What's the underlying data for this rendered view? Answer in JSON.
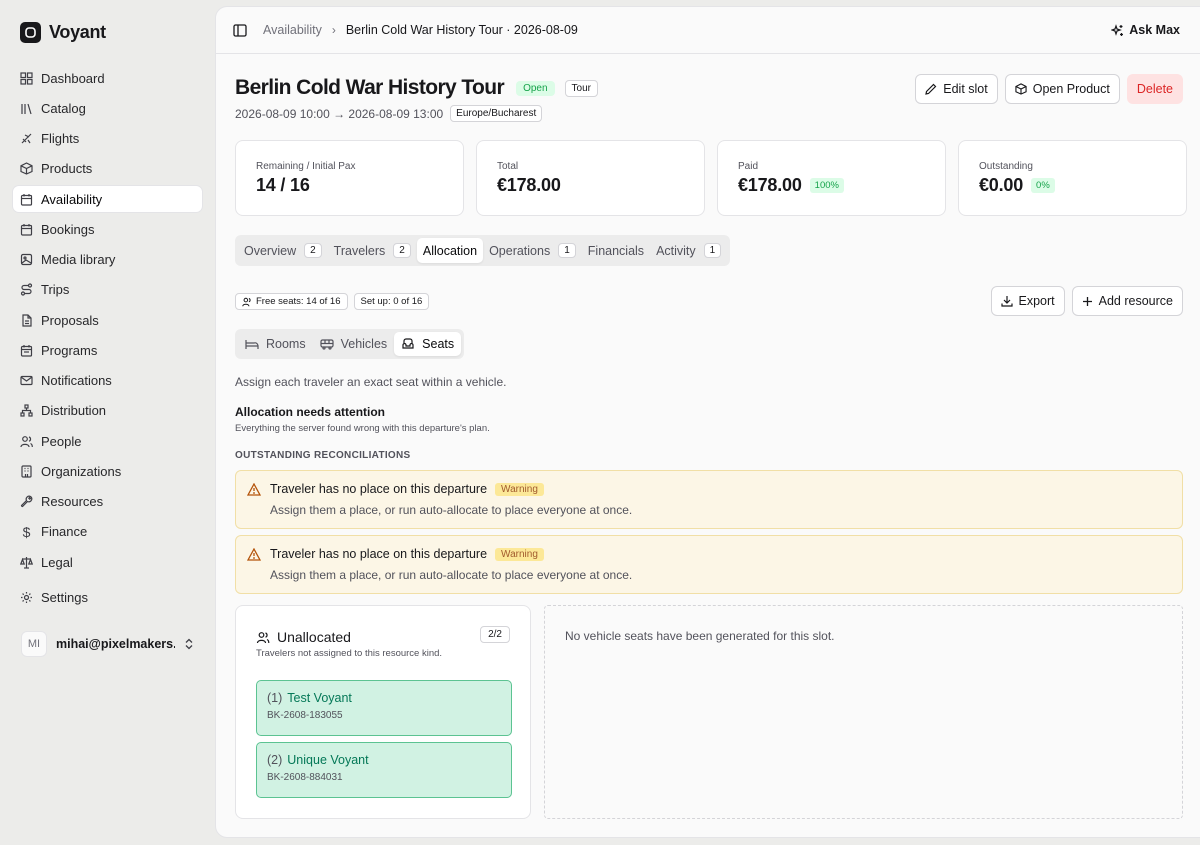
{
  "app": {
    "name": "Voyant"
  },
  "sidebar": {
    "items": [
      {
        "label": "Dashboard",
        "icon": "grid-icon"
      },
      {
        "label": "Catalog",
        "icon": "library-icon"
      },
      {
        "label": "Flights",
        "icon": "plane-icon"
      },
      {
        "label": "Products",
        "icon": "package-icon"
      },
      {
        "label": "Availability",
        "icon": "calendar-icon",
        "active": true
      },
      {
        "label": "Bookings",
        "icon": "calendar-check-icon"
      },
      {
        "label": "Media library",
        "icon": "image-icon"
      },
      {
        "label": "Trips",
        "icon": "route-icon"
      },
      {
        "label": "Proposals",
        "icon": "file-text-icon"
      },
      {
        "label": "Programs",
        "icon": "calendar-days-icon"
      },
      {
        "label": "Notifications",
        "icon": "mail-icon"
      },
      {
        "label": "Distribution",
        "icon": "network-icon"
      },
      {
        "label": "People",
        "icon": "users-icon"
      },
      {
        "label": "Organizations",
        "icon": "building-icon"
      },
      {
        "label": "Resources",
        "icon": "wrench-icon"
      },
      {
        "label": "Finance",
        "icon": "dollar-icon"
      },
      {
        "label": "Legal",
        "icon": "scale-icon"
      },
      {
        "label": "Settings",
        "icon": "gear-icon"
      }
    ],
    "user": {
      "initials": "MI",
      "email": "mihai@pixelmakers.c..."
    }
  },
  "topbar": {
    "crumb_parent": "Availability",
    "crumb_current": "Berlin Cold War History Tour · 2026-08-09",
    "ask_label": "Ask Max"
  },
  "header": {
    "title": "Berlin Cold War History Tour",
    "status_badge": "Open",
    "type_badge": "Tour",
    "time_range": "2026-08-09 10:00 → 2026-08-09 13:00",
    "timezone": "Europe/Bucharest",
    "edit_label": "Edit slot",
    "open_product_label": "Open Product",
    "delete_label": "Delete"
  },
  "stats": [
    {
      "label": "Remaining / Initial Pax",
      "value": "14 / 16",
      "pct": ""
    },
    {
      "label": "Total",
      "value": "€178.00",
      "pct": ""
    },
    {
      "label": "Paid",
      "value": "€178.00",
      "pct": "100%"
    },
    {
      "label": "Outstanding",
      "value": "€0.00",
      "pct": "0%"
    }
  ],
  "tabs": [
    {
      "label": "Overview",
      "count": "2"
    },
    {
      "label": "Travelers",
      "count": "2"
    },
    {
      "label": "Allocation",
      "count": "",
      "active": true
    },
    {
      "label": "Operations",
      "count": "1"
    },
    {
      "label": "Financials",
      "count": ""
    },
    {
      "label": "Activity",
      "count": "1"
    }
  ],
  "allocation": {
    "free_seats": "Free seats: 14 of 16",
    "set_up": "Set up: 0 of 16",
    "export_label": "Export",
    "add_resource_label": "Add resource",
    "subtabs": [
      "Rooms",
      "Vehicles",
      "Seats"
    ],
    "active_subtab": "Seats",
    "description": "Assign each traveler an exact seat within a vehicle.",
    "attention_title": "Allocation needs attention",
    "attention_sub": "Everything the server found wrong with this departure's plan.",
    "section_heading": "OUTSTANDING RECONCILIATIONS",
    "warnings": [
      {
        "title": "Traveler has no place on this departure",
        "badge": "Warning",
        "detail": "Assign them a place, or run auto-allocate to place everyone at once."
      },
      {
        "title": "Traveler has no place on this departure",
        "badge": "Warning",
        "detail": "Assign them a place, or run auto-allocate to place everyone at once."
      }
    ],
    "unallocated": {
      "title": "Unallocated",
      "count": "2/2",
      "sub": "Travelers not assigned to this resource kind.",
      "travelers": [
        {
          "index": "(1)",
          "name": "Test Voyant",
          "ref": "BK-2608-183055"
        },
        {
          "index": "(2)",
          "name": "Unique Voyant",
          "ref": "BK-2608-884031"
        }
      ]
    },
    "empty_message": "No vehicle seats have been generated for this slot."
  },
  "colors": {
    "accent_green": "#16a34a",
    "warning_bg": "#fcf6e6",
    "danger": "#dc2626",
    "traveler_bg": "#d1f2e3"
  }
}
